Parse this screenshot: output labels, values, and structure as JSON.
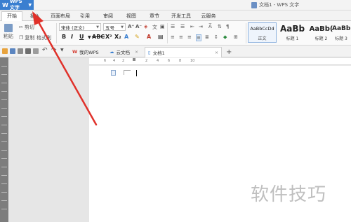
{
  "app": {
    "menu_label": "WPS 文字",
    "window_title": "文档1 - WPS 文字"
  },
  "ribbon_tabs": [
    "开始",
    "插入",
    "页面布局",
    "引用",
    "审阅",
    "视图",
    "章节",
    "开发工具",
    "云服务"
  ],
  "active_tab": "开始",
  "clipboard": {
    "paste": "粘贴",
    "cut": "剪切",
    "copy": "复制",
    "format_painter": "格式刷"
  },
  "font": {
    "family": "宋体 (正文)",
    "size": "五号"
  },
  "styles": [
    {
      "sample": "AaBbCcDd",
      "label": "正文"
    },
    {
      "sample": "AaBb",
      "label": "标题 1"
    },
    {
      "sample": "AaBb(",
      "label": "标题 2"
    },
    {
      "sample": "AaBb",
      "label": "标题 3"
    }
  ],
  "doc_tabs": [
    {
      "label": "我的WPS",
      "icon": "wps-icon"
    },
    {
      "label": "云文档",
      "icon": "cloud-icon"
    },
    {
      "label": "文档1",
      "icon": "document-icon"
    }
  ],
  "add_tab": "+",
  "ruler_numbers": [
    "6",
    "4",
    "2",
    "2",
    "4",
    "6",
    "8",
    "10"
  ],
  "watermark": "软件技巧",
  "colors": {
    "app_blue": "#3a7fd0",
    "arrow_red": "#e0312a"
  }
}
